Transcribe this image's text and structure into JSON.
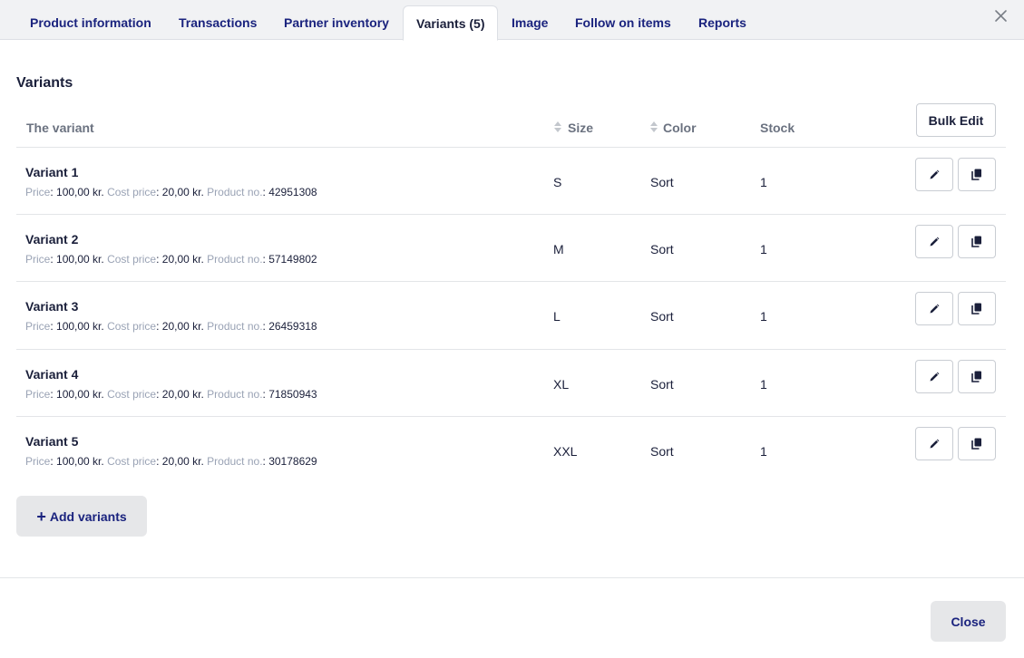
{
  "tabs": [
    {
      "label": "Product information"
    },
    {
      "label": "Transactions"
    },
    {
      "label": "Partner inventory"
    },
    {
      "label": "Variants (5)"
    },
    {
      "label": "Image"
    },
    {
      "label": "Follow on items"
    },
    {
      "label": "Reports"
    }
  ],
  "active_tab": "Variants (5)",
  "section_title": "Variants",
  "table": {
    "headers": {
      "variant": "The variant",
      "size": "Size",
      "color": "Color",
      "stock": "Stock"
    },
    "bulk_edit_label": "Bulk Edit",
    "meta_labels": {
      "price": "Price",
      "cost_price": "Cost price",
      "product_no": "Product no."
    },
    "rows": [
      {
        "name": "Variant 1",
        "price": "100,00 kr.",
        "cost_price": "20,00 kr.",
        "product_no": "42951308",
        "size": "S",
        "color": "Sort",
        "stock": "1"
      },
      {
        "name": "Variant 2",
        "price": "100,00 kr.",
        "cost_price": "20,00 kr.",
        "product_no": "57149802",
        "size": "M",
        "color": "Sort",
        "stock": "1"
      },
      {
        "name": "Variant 3",
        "price": "100,00 kr.",
        "cost_price": "20,00 kr.",
        "product_no": "26459318",
        "size": "L",
        "color": "Sort",
        "stock": "1"
      },
      {
        "name": "Variant 4",
        "price": "100,00 kr.",
        "cost_price": "20,00 kr.",
        "product_no": "71850943",
        "size": "XL",
        "color": "Sort",
        "stock": "1"
      },
      {
        "name": "Variant 5",
        "price": "100,00 kr.",
        "cost_price": "20,00 kr.",
        "product_no": "30178629",
        "size": "XXL",
        "color": "Sort",
        "stock": "1"
      }
    ]
  },
  "add_variants_label": "Add variants",
  "close_label": "Close",
  "icons": {
    "edit": "pencil-icon",
    "copy": "copy-icon",
    "close": "close-icon",
    "sort": "sort-icon",
    "add": "plus-icon"
  },
  "colors": {
    "brand_navy": "#1a237e",
    "muted_label": "#9aa3b5",
    "tabbar_bg": "#f1f2f4",
    "button_gray": "#e6e7e9"
  }
}
